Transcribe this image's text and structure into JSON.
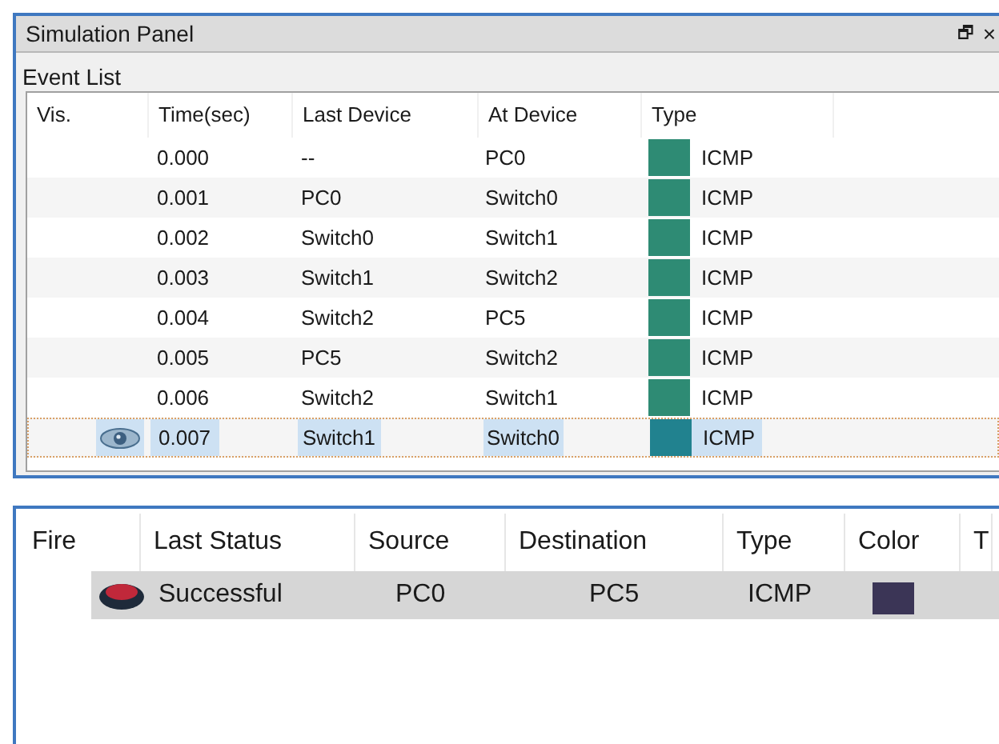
{
  "window": {
    "title": "Simulation Panel",
    "buttons": [
      "🗗",
      "×"
    ]
  },
  "event_list": {
    "title": "Event List",
    "columns": [
      "Vis.",
      "Time(sec)",
      "Last Device",
      "At Device",
      "Type"
    ],
    "rows": [
      {
        "time": "0.000",
        "last_device": "--",
        "at_device": "PC0",
        "type": "ICMP",
        "color": "#2e8b74",
        "selected": false
      },
      {
        "time": "0.001",
        "last_device": "PC0",
        "at_device": "Switch0",
        "type": "ICMP",
        "color": "#2e8b74",
        "selected": false
      },
      {
        "time": "0.002",
        "last_device": "Switch0",
        "at_device": "Switch1",
        "type": "ICMP",
        "color": "#2e8b74",
        "selected": false
      },
      {
        "time": "0.003",
        "last_device": "Switch1",
        "at_device": "Switch2",
        "type": "ICMP",
        "color": "#2e8b74",
        "selected": false
      },
      {
        "time": "0.004",
        "last_device": "Switch2",
        "at_device": "PC5",
        "type": "ICMP",
        "color": "#2e8b74",
        "selected": false
      },
      {
        "time": "0.005",
        "last_device": "PC5",
        "at_device": "Switch2",
        "type": "ICMP",
        "color": "#2e8b74",
        "selected": false
      },
      {
        "time": "0.006",
        "last_device": "Switch2",
        "at_device": "Switch1",
        "type": "ICMP",
        "color": "#2e8b74",
        "selected": false
      },
      {
        "time": "0.007",
        "last_device": "Switch1",
        "at_device": "Switch0",
        "type": "ICMP",
        "color": "#21828f",
        "selected": true
      }
    ]
  },
  "pdu_list": {
    "columns": [
      "Fire",
      "Last Status",
      "Source",
      "Destination",
      "Type",
      "Color",
      "T"
    ],
    "rows": [
      {
        "last_status": "Successful",
        "source": "PC0",
        "destination": "PC5",
        "type": "ICMP",
        "color": "#3b3556"
      }
    ]
  }
}
